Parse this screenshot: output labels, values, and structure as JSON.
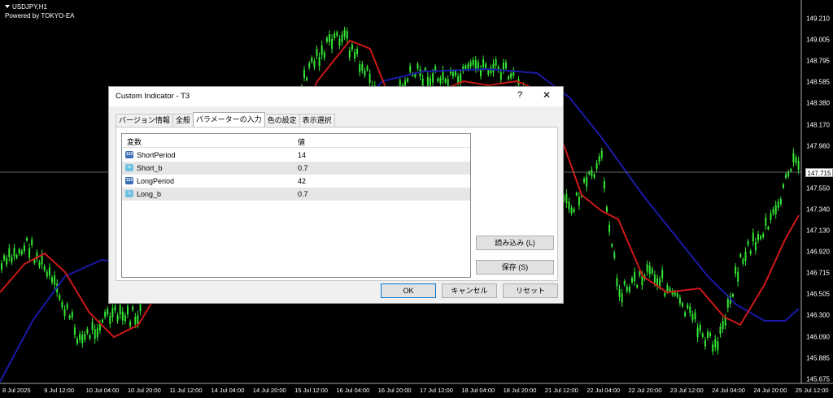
{
  "chart": {
    "symbol": "USDJPY,H1",
    "powered": "Powered by TOKYO-EA",
    "price_axis": [
      "149.210",
      "149.005",
      "148.795",
      "148.585",
      "148.380",
      "148.170",
      "147.960",
      "147.550",
      "147.340",
      "147.130",
      "146.920",
      "146.715",
      "146.505",
      "146.300",
      "146.090",
      "145.885",
      "145.675"
    ],
    "current_price": "147.715",
    "time_axis": [
      "8 Jul 2025",
      "9 Jul 12:00",
      "10 Jul 04:00",
      "10 Jul 20:00",
      "11 Jul 12:00",
      "14 Jul 04:00",
      "14 Jul 20:00",
      "15 Jul 12:00",
      "16 Jul 04:00",
      "16 Jul 20:00",
      "17 Jul 12:00",
      "18 Jul 04:00",
      "18 Jul 20:00",
      "21 Jul 12:00",
      "22 Jul 04:00",
      "22 Jul 20:00",
      "23 Jul 12:00",
      "24 Jul 04:00",
      "24 Jul 20:00",
      "25 Jul 12:00"
    ],
    "colors": {
      "candles": "#33e833",
      "short_t3": "#d01818",
      "long_t3": "#1a1aa8"
    }
  },
  "dialog": {
    "title": "Custom Indicator - T3",
    "help": "?",
    "close": "✕",
    "tabs": [
      "バージョン情報",
      "全般",
      "パラメーターの入力",
      "色の設定",
      "表示選択"
    ],
    "active_tab": 2,
    "columns": {
      "variable": "変数",
      "value": "値"
    },
    "params": [
      {
        "icon": "123",
        "name": "ShortPeriod",
        "value": "14"
      },
      {
        "icon": "½",
        "name": "Short_b",
        "value": "0.7"
      },
      {
        "icon": "123",
        "name": "LongPeriod",
        "value": "42"
      },
      {
        "icon": "½",
        "name": "Long_b",
        "value": "0.7"
      }
    ],
    "buttons": {
      "load": "読み込み (L)",
      "save": "保存 (S)",
      "ok": "OK",
      "cancel": "キャンセル",
      "reset": "リセット"
    }
  }
}
